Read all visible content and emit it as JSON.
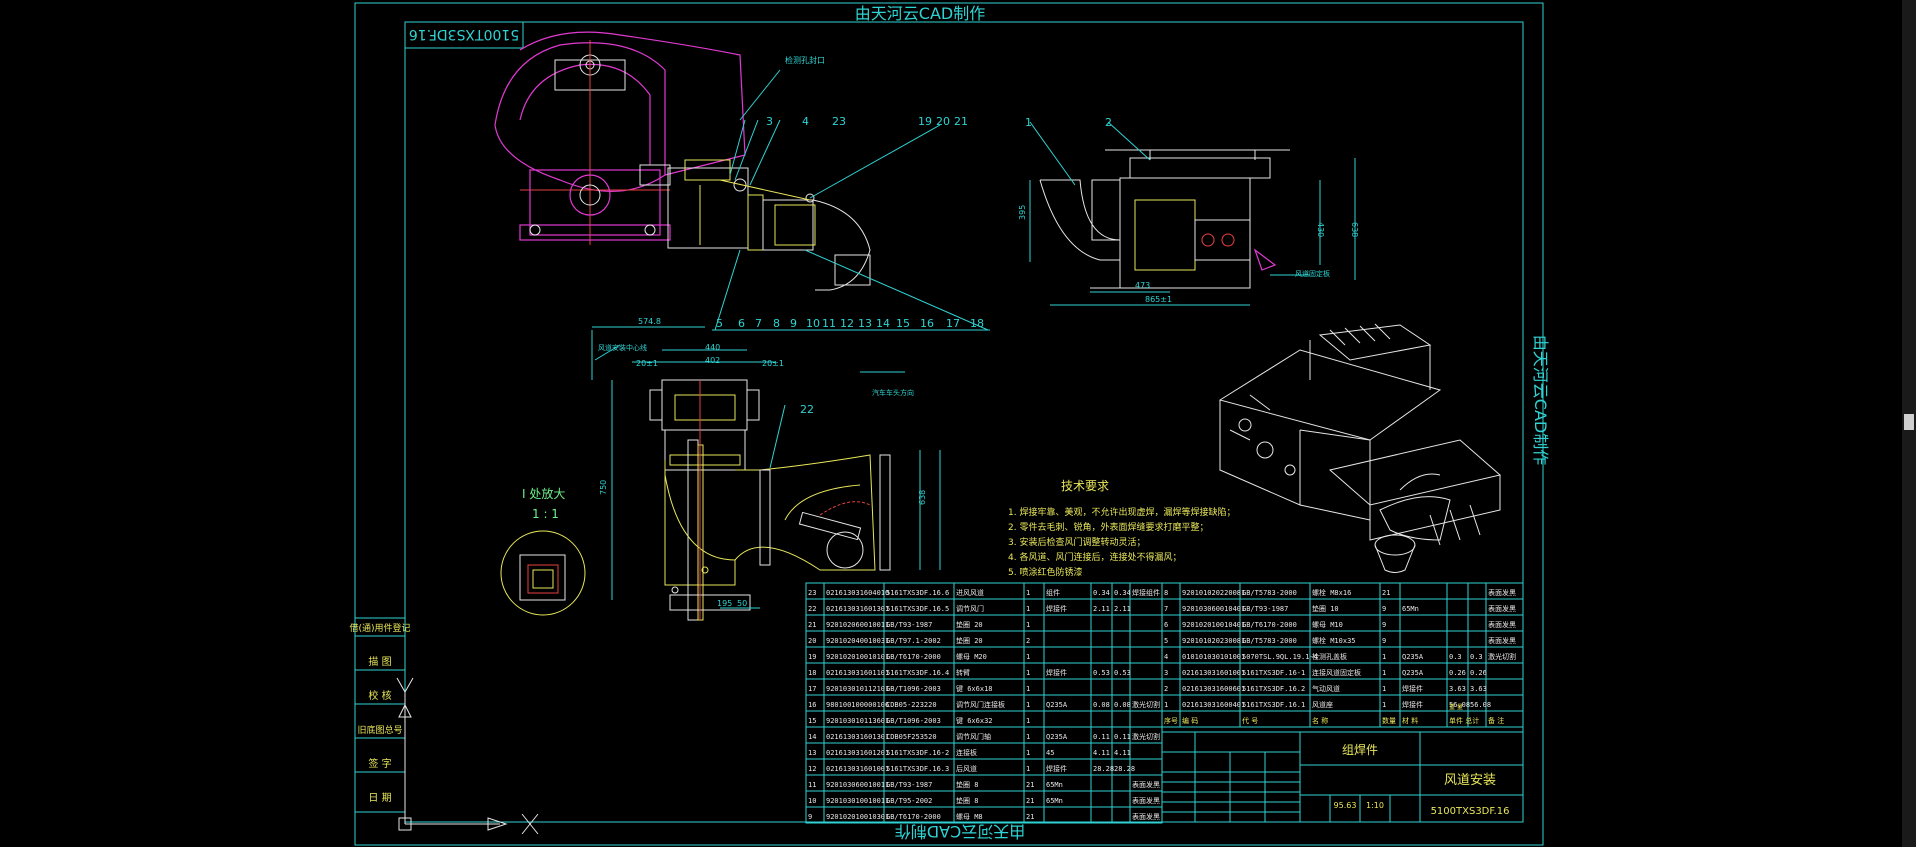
{
  "watermark_top": "由天河云CAD制作",
  "watermark_bottom": "由天河云CAD制作",
  "watermark_right": "由天河云CAD制作",
  "drawing_code_mirrored": "5100TXS3DF.16",
  "views": {
    "top_left_callouts": [
      "3",
      "4",
      "23",
      "19",
      "20",
      "21"
    ],
    "top_left_bottom_callouts": [
      "5",
      "6",
      "7",
      "8",
      "9",
      "10",
      "11",
      "12",
      "13",
      "14",
      "15",
      "16",
      "17",
      "18"
    ],
    "top_right_callouts": [
      "1",
      "2"
    ],
    "top_right_dims": {
      "d1": "473",
      "d2": "865±1",
      "d3": "395",
      "d4": "430",
      "d5": "638"
    },
    "top_right_note": "风道固定板",
    "top_note_left": "检测孔封口",
    "bottom_view_dims": {
      "w1": "574.8",
      "w2": "440",
      "w3": "402",
      "w4": "20±1",
      "w5": "20±1",
      "h1": "750",
      "h2": "638",
      "b1": "195",
      "b2": "50"
    },
    "bottom_view_callout": "22",
    "bottom_view_note_left": "风道安装中心线",
    "bottom_view_note_right": "汽车车头方向",
    "detail_title": "I 处放大",
    "detail_scale": "1 : 1"
  },
  "tech_requirements": {
    "title": "技术要求",
    "items": [
      "1. 焊接牢靠、美观，不允许出现虚焊，漏焊等焊接缺陷；",
      "2. 零件去毛刺、锐角，外表面焊缝要求打磨平整；",
      "3. 安装后检查风门调整转动灵活；",
      "4. 各风道、风门连接后，连接处不得漏风；",
      "5. 喷涂红色防锈漆"
    ]
  },
  "bom_left": [
    {
      "no": "23",
      "code": "021613031604010",
      "spec": "5161TXS3DF.16.6",
      "name": "进风风道",
      "qty": "1",
      "mat": "组件",
      "w1": "0.34",
      "w2": "0.34",
      "note": "焊接组件"
    },
    {
      "no": "22",
      "code": "021613031601301",
      "spec": "5161TXS3DF.16.5",
      "name": "调节风门",
      "qty": "1",
      "mat": "焊接件",
      "w1": "2.11",
      "w2": "2.11",
      "note": ""
    },
    {
      "no": "21",
      "code": "920102060010011",
      "spec": "GB/T93-1987",
      "name": "垫圈 20",
      "qty": "1",
      "mat": "",
      "w1": "",
      "w2": "",
      "note": ""
    },
    {
      "no": "20",
      "code": "920102040010031",
      "spec": "GB/T97.1-2002",
      "name": "垫圈 20",
      "qty": "2",
      "mat": "",
      "w1": "",
      "w2": "",
      "note": ""
    },
    {
      "no": "19",
      "code": "920102010010101",
      "spec": "GB/T6170-2000",
      "name": "螺母 M20",
      "qty": "1",
      "mat": "",
      "w1": "",
      "w2": "",
      "note": ""
    },
    {
      "no": "18",
      "code": "021613031601101",
      "spec": "5161TXS3DF.16.4",
      "name": "转臂",
      "qty": "1",
      "mat": "焊接件",
      "w1": "0.53",
      "w2": "0.53",
      "note": ""
    },
    {
      "no": "17",
      "code": "920103010112101",
      "spec": "GB/T1096-2003",
      "name": "键 6x6x18",
      "qty": "1",
      "mat": "",
      "w1": "",
      "w2": "",
      "note": ""
    },
    {
      "no": "16",
      "code": "980100100000106",
      "spec": "CDB05-223220",
      "name": "调节风门连接板",
      "qty": "1",
      "mat": "Q235A",
      "w1": "0.08",
      "w2": "0.08",
      "note": "激光切割"
    },
    {
      "no": "15",
      "code": "920103010113601",
      "spec": "GB/T1096-2003",
      "name": "键 6x6x32",
      "qty": "1",
      "mat": "",
      "w1": "",
      "w2": "",
      "note": ""
    },
    {
      "no": "14",
      "code": "021613031601301",
      "spec": "CDB05F253520",
      "name": "调节风门轴",
      "qty": "1",
      "mat": "Q235A",
      "w1": "0.11",
      "w2": "0.11",
      "note": "激光切割"
    },
    {
      "no": "13",
      "code": "021613031601201",
      "spec": "5161TXS3DF.16-2",
      "name": "连接板",
      "qty": "1",
      "mat": "45",
      "w1": "4.11",
      "w2": "4.11",
      "note": ""
    },
    {
      "no": "12",
      "code": "021613031601001",
      "spec": "5161TXS3DF.16.3",
      "name": "后风道",
      "qty": "1",
      "mat": "焊接件",
      "w1": "28.28",
      "w2": "28.28",
      "note": ""
    },
    {
      "no": "11",
      "code": "920103060010011",
      "spec": "GB/T93-1987",
      "name": "垫圈 8",
      "qty": "21",
      "mat": "65Mn",
      "w1": "",
      "w2": "",
      "note": "表面发黑"
    },
    {
      "no": "10",
      "code": "920103010010011",
      "spec": "GB/T95-2002",
      "name": "垫圈 8",
      "qty": "21",
      "mat": "65Mn",
      "w1": "",
      "w2": "",
      "note": "表面发黑"
    },
    {
      "no": "9",
      "code": "920102010010301",
      "spec": "GB/T6170-2000",
      "name": "螺母 M8",
      "qty": "21",
      "mat": "",
      "w1": "",
      "w2": "",
      "note": "表面发黑"
    }
  ],
  "bom_right": [
    {
      "no": "8",
      "code": "920101020220081",
      "spec": "GB/T5783-2000",
      "name": "螺栓 M8x16",
      "qty": "21",
      "mat": "",
      "w1": "",
      "w2": "",
      "note": "表面发黑"
    },
    {
      "no": "7",
      "code": "920103060010401",
      "spec": "GB/T93-1987",
      "name": "垫圈 10",
      "qty": "9",
      "mat": "65Mn",
      "w1": "",
      "w2": "",
      "note": "表面发黑"
    },
    {
      "no": "6",
      "code": "920102010010401",
      "spec": "GB/T6170-2000",
      "name": "螺母 M10",
      "qty": "9",
      "mat": "",
      "w1": "",
      "w2": "",
      "note": "表面发黑"
    },
    {
      "no": "5",
      "code": "920101020230081",
      "spec": "GB/T5783-2000",
      "name": "螺栓 M10x35",
      "qty": "9",
      "mat": "",
      "w1": "",
      "w2": "",
      "note": "表面发黑"
    },
    {
      "no": "4",
      "code": "010101030101001",
      "spec": "5070TSL.9QL.19.1-4",
      "name": "检测孔盖板",
      "qty": "1",
      "mat": "Q235A",
      "w1": "0.3",
      "w2": "0.3",
      "note": "激光切割"
    },
    {
      "no": "3",
      "code": "021613031601001",
      "spec": "5161TXS3DF.16-1",
      "name": "连接风道固定板",
      "qty": "1",
      "mat": "Q235A",
      "w1": "0.26",
      "w2": "0.26",
      "note": ""
    },
    {
      "no": "2",
      "code": "021613031600601",
      "spec": "5161TXS3DF.16.2",
      "name": "气动风道",
      "qty": "1",
      "mat": "焊接件",
      "w1": "3.63",
      "w2": "3.63",
      "note": ""
    },
    {
      "no": "1",
      "code": "021613031600401",
      "spec": "5161TXS3DF.16.1",
      "name": "风道座",
      "qty": "1",
      "mat": "焊接件",
      "w1": "56.08",
      "w2": "56.08",
      "note": ""
    }
  ],
  "bom_header": {
    "no": "序号",
    "code": "编 码",
    "spec": "代 号",
    "name": "名 称",
    "qty": "数量",
    "mat": "材 料",
    "weight": "单件 总计",
    "note": "备 注",
    "weight_label": "重 量"
  },
  "title_block": {
    "part_type": "组焊件",
    "part_name": "风道安装",
    "drawing_no": "5100TXS3DF.16",
    "weight": "95.63",
    "scale": "1:10"
  },
  "side_block": [
    "借(通)用件登记",
    "描 图",
    "校 核",
    "旧底图总号",
    "签 字",
    "日 期"
  ]
}
